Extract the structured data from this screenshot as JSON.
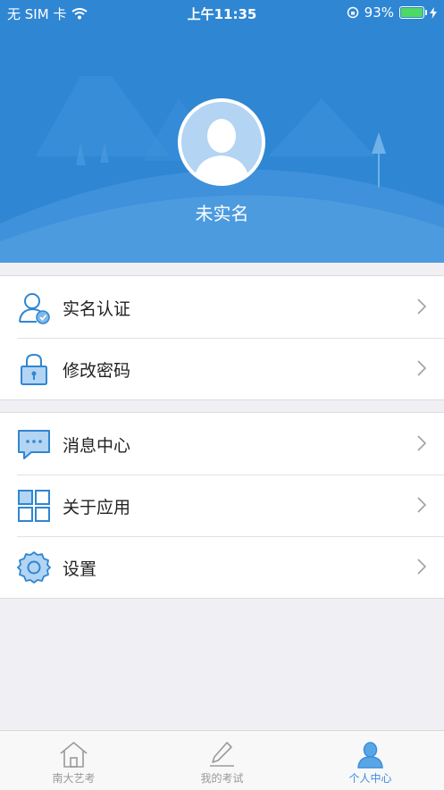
{
  "status_bar": {
    "carrier": "无 SIM 卡",
    "time": "上午11:35",
    "battery_percent": "93%",
    "battery_level": 0.93,
    "accent_battery": "#4cd964"
  },
  "header": {
    "username": "未实名",
    "background_color": "#2f86d3"
  },
  "menu_groups": [
    {
      "items": [
        {
          "label": "实名认证",
          "icon": "user-verify-icon"
        },
        {
          "label": "修改密码",
          "icon": "lock-icon"
        }
      ]
    },
    {
      "items": [
        {
          "label": "消息中心",
          "icon": "message-icon"
        },
        {
          "label": "关于应用",
          "icon": "grid-icon"
        },
        {
          "label": "设置",
          "icon": "gear-icon"
        }
      ]
    }
  ],
  "tabbar": {
    "tabs": [
      {
        "label": "南大艺考",
        "icon": "home-icon",
        "active": false
      },
      {
        "label": "我的考试",
        "icon": "pencil-icon",
        "active": false
      },
      {
        "label": "个人中心",
        "icon": "person-icon",
        "active": true
      }
    ],
    "active_color": "#3a8ee0"
  }
}
